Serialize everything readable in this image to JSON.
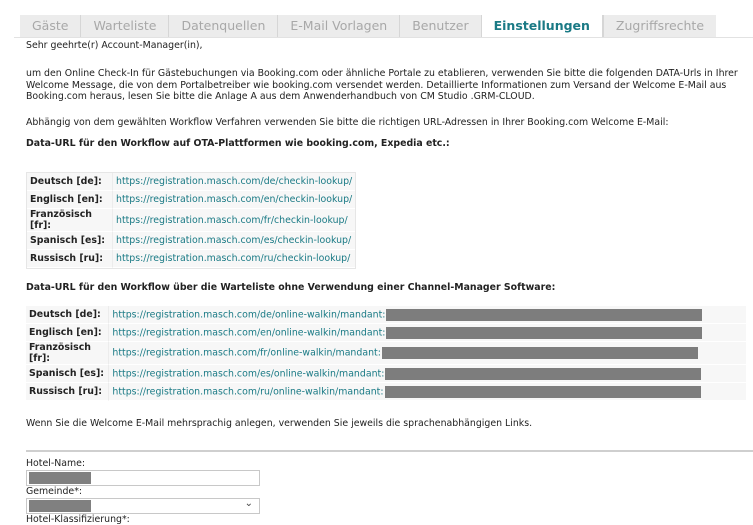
{
  "tabs": [
    {
      "label": "Gäste",
      "active": false
    },
    {
      "label": "Warteliste",
      "active": false
    },
    {
      "label": "Datenquellen",
      "active": false
    },
    {
      "label": "E-Mail Vorlagen",
      "active": false
    },
    {
      "label": "Benutzer",
      "active": false
    },
    {
      "label": "Einstellungen",
      "active": true
    },
    {
      "label": "Zugriffsrechte",
      "active": false
    }
  ],
  "intro": {
    "greeting": "Sehr geehrte(r) Account-Manager(in),",
    "paragraph": "um den Online Check-In für Gästebuchungen via Booking.com oder ähnliche Portale zu etablieren, verwenden Sie bitte die folgenden DATA-Urls in Ihrer Welcome Message, die von dem Portalbetreiber wie booking.com versendet werden. Detaillierte Informationen zum Versand der Welcome E-Mail aus Booking.com heraus, lesen Sie bitte die Anlage A aus dem Anwenderhandbuch von CM Studio .GRM-CLOUD.",
    "workflow_note": "Abhängig von dem gewählten Workflow Verfahren verwenden Sie bitte die richtigen URL-Adressen in Ihrer Booking.com Welcome E-Mail:"
  },
  "section_ota": {
    "heading": "Data-URL für den Workflow auf OTA-Plattformen wie booking.com, Expedia etc.:",
    "rows": [
      {
        "lang": "Deutsch [de]:",
        "url": "https://registration.masch.com/de/checkin-lookup/"
      },
      {
        "lang": "Englisch [en]:",
        "url": "https://registration.masch.com/en/checkin-lookup/"
      },
      {
        "lang": "Französisch [fr]:",
        "url": "https://registration.masch.com/fr/checkin-lookup/"
      },
      {
        "lang": "Spanisch [es]:",
        "url": "https://registration.masch.com/es/checkin-lookup/"
      },
      {
        "lang": "Russisch [ru]:",
        "url": "https://registration.masch.com/ru/checkin-lookup/"
      }
    ]
  },
  "section_walkin": {
    "heading": "Data-URL für den Workflow über die Warteliste ohne Verwendung einer Channel-Manager Software:",
    "rows": [
      {
        "lang": "Deutsch [de]:",
        "url": "https://registration.masch.com/de/online-walkin/mandant:"
      },
      {
        "lang": "Englisch [en]:",
        "url": "https://registration.masch.com/en/online-walkin/mandant:"
      },
      {
        "lang": "Französisch [fr]:",
        "url": "https://registration.masch.com/fr/online-walkin/mandant:"
      },
      {
        "lang": "Spanisch [es]:",
        "url": "https://registration.masch.com/es/online-walkin/mandant:"
      },
      {
        "lang": "Russisch [ru]:",
        "url": "https://registration.masch.com/ru/online-walkin/mandant:"
      }
    ]
  },
  "multilang_note": "Wenn Sie die Welcome E-Mail mehrsprachig anlegen, verwenden Sie jeweils die sprachenabhängigen Links.",
  "form": {
    "hotel_name_label": "Hotel-Name:",
    "gemeinde_label": "Gemeinde*:",
    "klassifizierung_label": "Hotel-Klassifizierung*:"
  },
  "colors": {
    "accent": "#1a7a85",
    "redaction": "#7d7d7d"
  },
  "icons": {
    "select_chevron": "chevron-down-icon"
  }
}
